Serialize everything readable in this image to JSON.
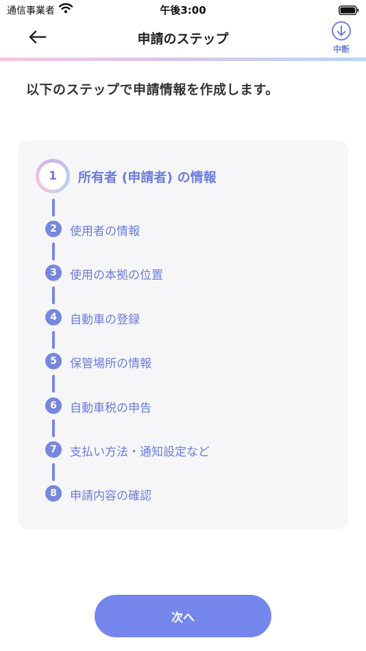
{
  "status_bar": {
    "carrier": "通信事業者",
    "time": "午後3:00"
  },
  "nav": {
    "title": "申請のステップ",
    "suspend_label": "中断"
  },
  "intro": "以下のステップで申請情報を作成します。",
  "steps": [
    {
      "number": "1",
      "label": "所有者 (申請者) の情報",
      "current": true
    },
    {
      "number": "2",
      "label": "使用者の情報"
    },
    {
      "number": "3",
      "label": "使用の本拠の位置"
    },
    {
      "number": "4",
      "label": "自動車の登録"
    },
    {
      "number": "5",
      "label": "保管場所の情報"
    },
    {
      "number": "6",
      "label": "自動車税の申告"
    },
    {
      "number": "7",
      "label": "支払い方法・通知設定など"
    },
    {
      "number": "8",
      "label": "申請内容の確認"
    }
  ],
  "next_button": "次へ",
  "colors": {
    "accent": "#7587ec",
    "step_text": "#6b7ddd",
    "card_background": "#f6f6f8"
  }
}
